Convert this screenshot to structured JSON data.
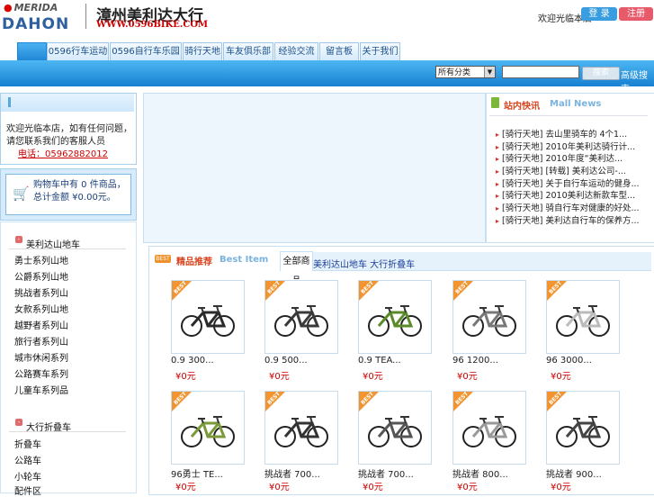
{
  "header": {
    "brand1": "MERIDA",
    "brand2": "DAHON",
    "store_name": "漳州美利达大行",
    "store_url": "WWW.0596BIKE.COM",
    "welcome": "欢迎光临本店",
    "login_label": "登 录",
    "register_label": "注册"
  },
  "nav": {
    "tabs": [
      "",
      "0596行车运动",
      "0596自行车乐园",
      "骑行天地",
      "车友俱乐部",
      "经验交流",
      "留言板",
      "关于我们"
    ]
  },
  "search": {
    "category": "所有分类",
    "button": "搜索",
    "advanced": "高级搜索"
  },
  "notice": {
    "text": "欢迎光临本店，如有任何问题，请您联系我们的客服人员",
    "phone": "电话：05962882012"
  },
  "cart": {
    "text": "购物车中有 0 件商品，总计金额 ¥0.00元。"
  },
  "categories": {
    "group1_title": "美利达山地车",
    "group1_items": [
      "勇士系列山地",
      "公爵系列山地",
      "挑战者系列山",
      "女款系列山地",
      "越野者系列山",
      "旅行者系列山",
      "城市休闲系列",
      "公路赛车系列",
      "儿童车系列品"
    ],
    "group2_title": "大行折叠车",
    "group2_items": [
      "折叠车",
      "公路车",
      "小轮车",
      "配件区"
    ]
  },
  "news": {
    "title": "站内快讯",
    "title_en": "Mall News",
    "items": [
      {
        "tag": "[骑行天地]",
        "text": "去山里骑车的 4个1..."
      },
      {
        "tag": "[骑行天地]",
        "text": "2010年美利达骑行计..."
      },
      {
        "tag": "[骑行天地]",
        "text": "2010年度“美利达..."
      },
      {
        "tag": "[骑行天地]",
        "text": "[转载] 美利达公司-..."
      },
      {
        "tag": "[骑行天地]",
        "text": "关于自行车运动的健身..."
      },
      {
        "tag": "[骑行天地]",
        "text": "2010美利达新款车型..."
      },
      {
        "tag": "[骑行天地]",
        "text": "骑自行车对健康的好处..."
      },
      {
        "tag": "[骑行天地]",
        "text": "美利达自行车的保养方..."
      }
    ]
  },
  "products": {
    "badge": "BEST",
    "title": "精品推荐",
    "title_en": "Best Item",
    "tab_active": "全部商品",
    "tab_other": "美利达山地车 大行折叠车",
    "items": [
      {
        "name": "0.9 300...",
        "price": "¥0元",
        "frame": "#2a2a2a"
      },
      {
        "name": "0.9 500...",
        "price": "¥0元",
        "frame": "#3a3a3a"
      },
      {
        "name": "0.9 TEA...",
        "price": "¥0元",
        "frame": "#5a8a2a"
      },
      {
        "name": "96 1200...",
        "price": "¥0元",
        "frame": "#777777"
      },
      {
        "name": "96 3000...",
        "price": "¥0元",
        "frame": "#bbbbbb"
      },
      {
        "name": "96勇士 TE...",
        "price": "¥0元",
        "frame": "#7a9a3a"
      },
      {
        "name": "挑战者 700...",
        "price": "¥0元",
        "frame": "#333333"
      },
      {
        "name": "挑战者 700...",
        "price": "¥0元",
        "frame": "#555555"
      },
      {
        "name": "挑战者 800...",
        "price": "¥0元",
        "frame": "#999999"
      },
      {
        "name": "挑战者 900...",
        "price": "¥0元",
        "frame": "#444444"
      }
    ]
  }
}
